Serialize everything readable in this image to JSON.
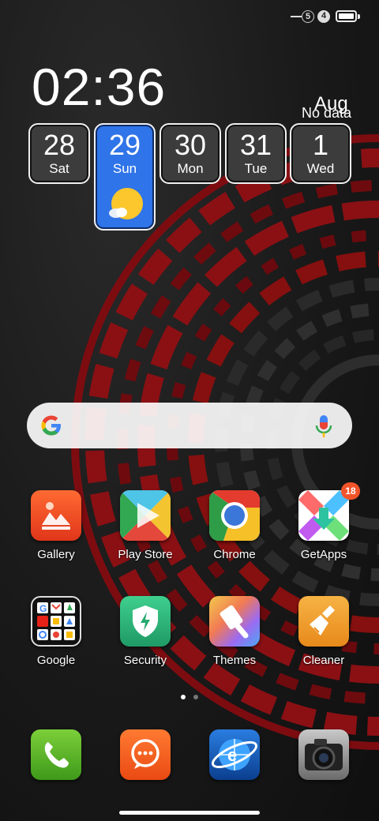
{
  "status_bar": {
    "sim1": "5",
    "sim2": "4",
    "icons": [
      "sim-line-icon",
      "sim-5-icon",
      "sim-4-icon",
      "battery-full-icon"
    ]
  },
  "clock": {
    "time": "02:36"
  },
  "weather": {
    "month": "Aug",
    "status": "No data",
    "icon": "partly-sunny-icon"
  },
  "calendar": {
    "days": [
      {
        "num": "28",
        "name": "Sat"
      },
      {
        "num": "29",
        "name": "Sun"
      },
      {
        "num": "30",
        "name": "Mon"
      },
      {
        "num": "31",
        "name": "Tue"
      },
      {
        "num": "1",
        "name": "Wed"
      }
    ],
    "today_index": 1,
    "accent": "#2f74e8"
  },
  "search": {
    "placeholder": "",
    "icons": [
      "google-logo-icon",
      "microphone-icon"
    ]
  },
  "apps": [
    {
      "label": "Gallery",
      "icon": "gallery-icon"
    },
    {
      "label": "Play Store",
      "icon": "play-store-icon"
    },
    {
      "label": "Chrome",
      "icon": "chrome-icon"
    },
    {
      "label": "GetApps",
      "icon": "getapps-icon",
      "badge": "18"
    },
    {
      "label": "Google",
      "icon": "google-folder-icon"
    },
    {
      "label": "Security",
      "icon": "security-shield-icon"
    },
    {
      "label": "Themes",
      "icon": "themes-brush-icon"
    },
    {
      "label": "Cleaner",
      "icon": "cleaner-broom-icon"
    }
  ],
  "pager": {
    "count": 2,
    "active": 0
  },
  "dock": [
    {
      "icon": "phone-icon"
    },
    {
      "icon": "messages-icon"
    },
    {
      "icon": "browser-icon"
    },
    {
      "icon": "camera-icon"
    }
  ]
}
